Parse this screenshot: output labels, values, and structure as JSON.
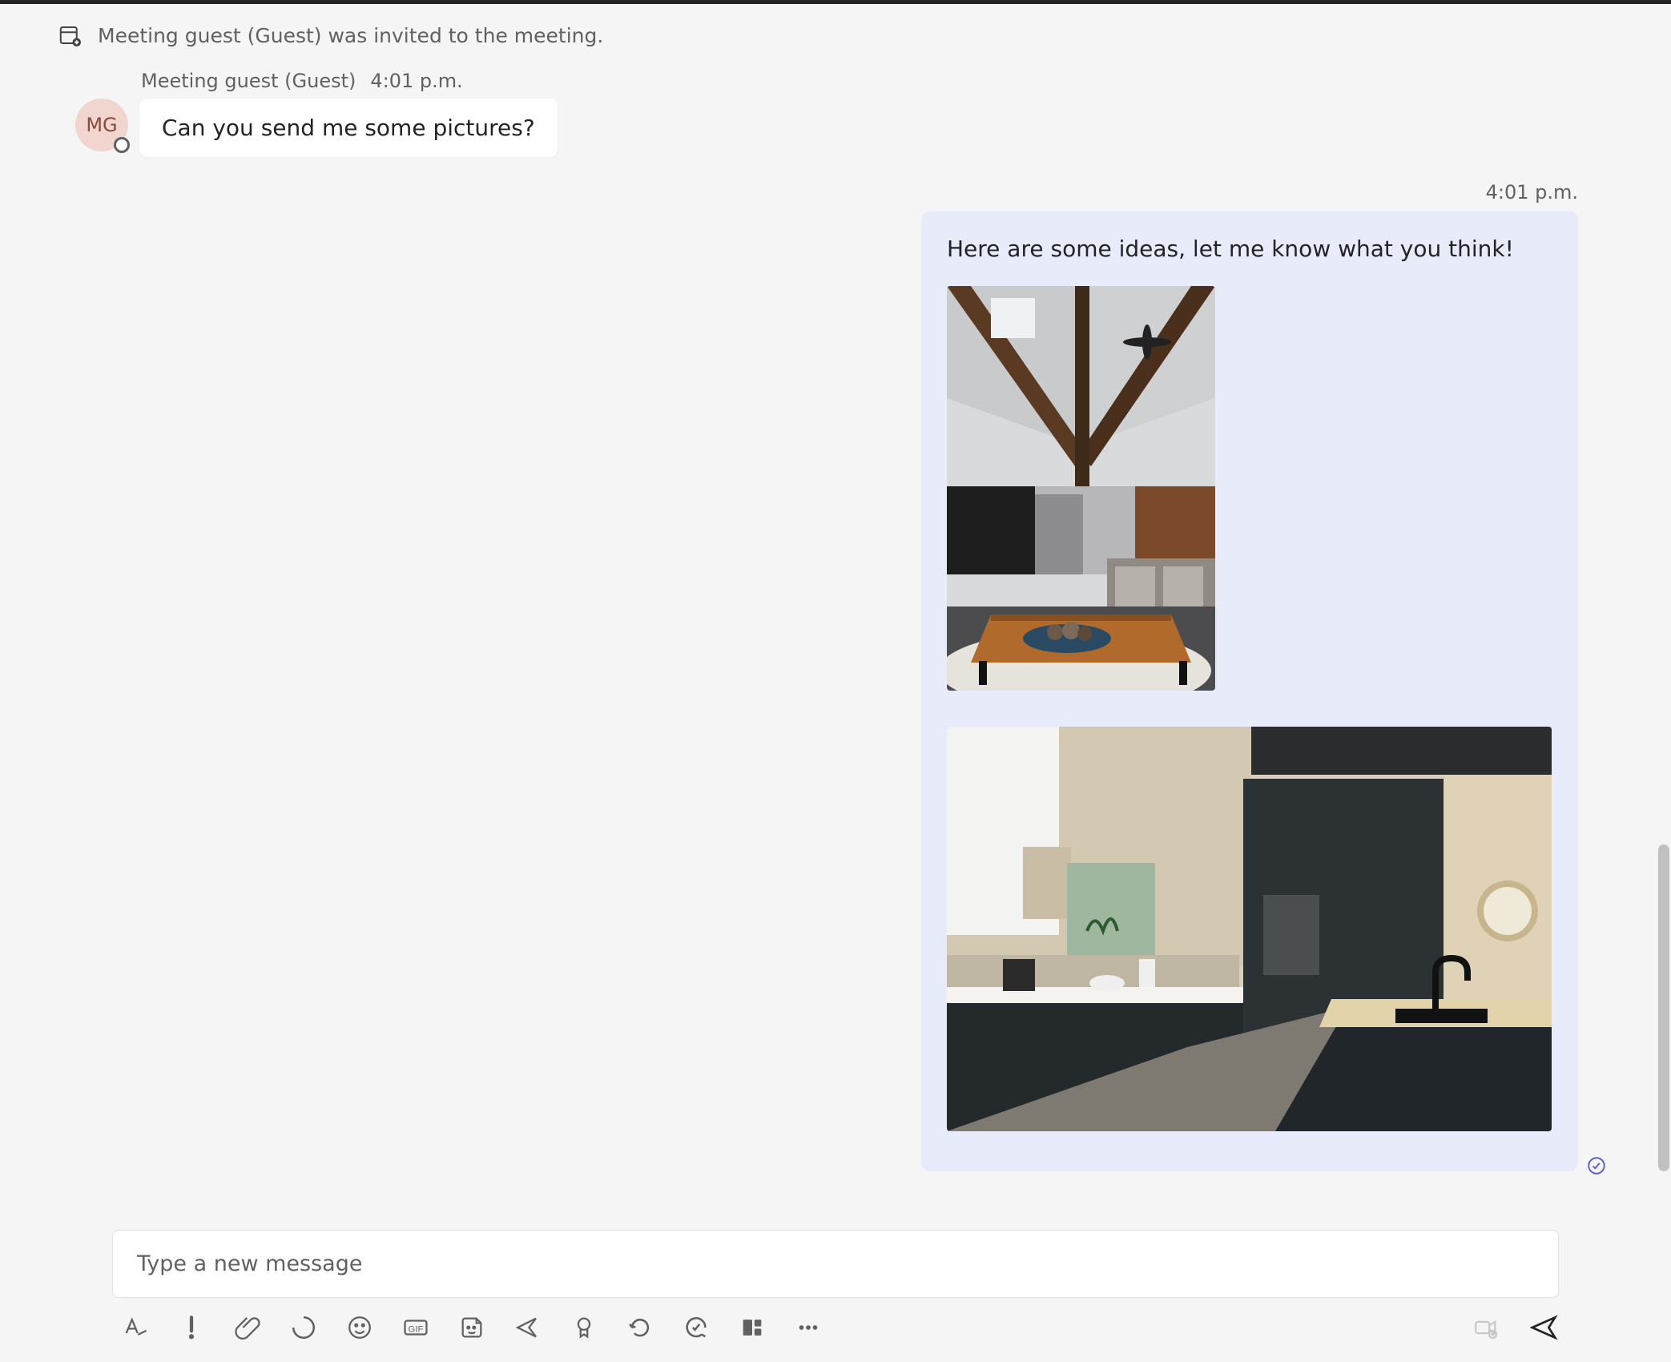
{
  "system_event": {
    "text": "Meeting guest (Guest) was invited to the meeting."
  },
  "incoming": {
    "sender_name": "Meeting guest (Guest)",
    "timestamp": "4:01 p.m.",
    "avatar_initials": "MG",
    "message_text": "Can you send me some pictures?"
  },
  "outgoing": {
    "timestamp": "4:01 p.m.",
    "message_text": "Here are some ideas, let me know what you think!",
    "attachments": [
      {
        "kind": "image",
        "alt": "Rustic living room with wooden beams and coffee table"
      },
      {
        "kind": "image",
        "alt": "Modern kitchen with dark cabinets and wood countertop island"
      }
    ]
  },
  "composer": {
    "placeholder": "Type a new message"
  },
  "toolbar_icons": {
    "format": "format-icon",
    "priority": "priority-icon",
    "attach": "attach-icon",
    "loop": "loop-icon",
    "emoji": "emoji-icon",
    "gif": "gif-icon",
    "sticker": "sticker-icon",
    "sendlater": "sendlater-icon",
    "approve": "approvals-icon",
    "refresh": "updates-icon",
    "poll": "poll-icon",
    "stream": "stream-icon",
    "more": "more-icon",
    "video": "video-icon",
    "send": "send-icon"
  }
}
